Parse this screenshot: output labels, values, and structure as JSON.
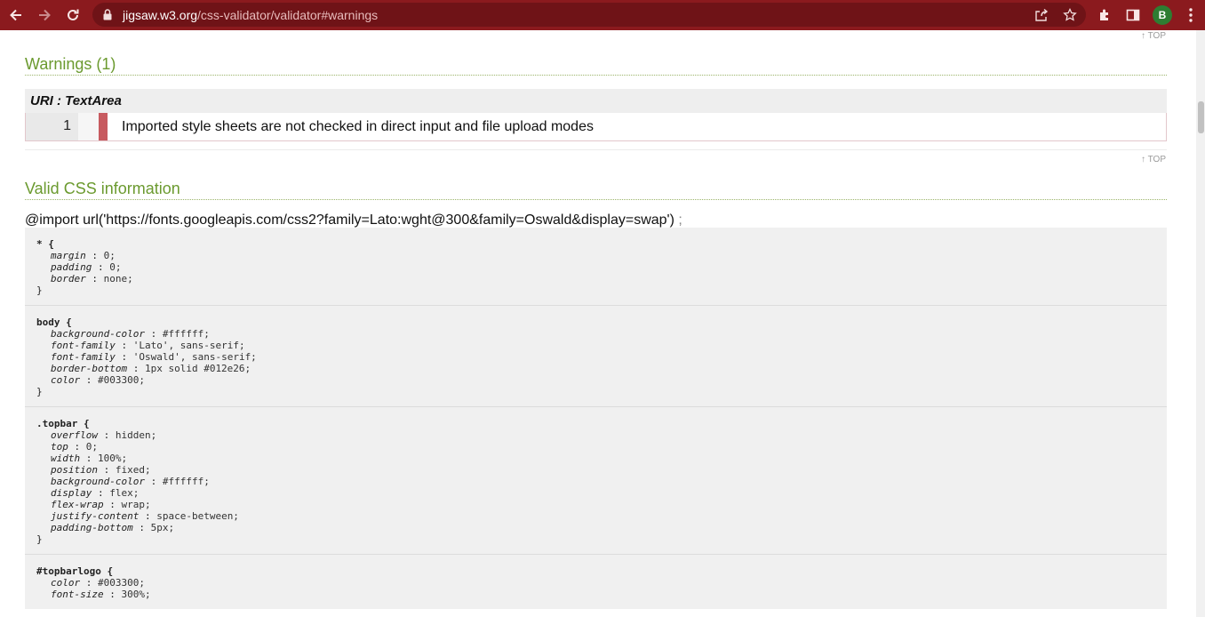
{
  "browser": {
    "url_domain": "jigsaw.w3.org",
    "url_path": "/css-validator/validator#warnings",
    "avatar_letter": "B",
    "theme_color": "#8b1a1e"
  },
  "icons": [
    "back-icon",
    "forward-icon",
    "reload-icon",
    "lock-icon",
    "share-icon",
    "star-icon",
    "extensions-icon",
    "side-panel-icon",
    "menu-icon"
  ],
  "page": {
    "top_link": "↑ TOP",
    "warnings": {
      "title": "Warnings (1)",
      "uri_label": "URI : TextArea",
      "items": [
        {
          "line": "1",
          "message": "Imported style sheets are not checked in direct input and file upload modes"
        }
      ]
    },
    "valid": {
      "title": "Valid CSS information",
      "import_text": "@import url('https://fonts.googleapis.com/css2?family=Lato:wght@300&family=Oswald&display=swap')",
      "import_semi": ";",
      "rules": [
        {
          "selector": "* {",
          "declarations": [
            {
              "prop": "margin",
              "value": "0;"
            },
            {
              "prop": "padding",
              "value": "0;"
            },
            {
              "prop": "border",
              "value": "none;"
            }
          ],
          "close": "}"
        },
        {
          "selector": "body {",
          "declarations": [
            {
              "prop": "background-color",
              "value": "#ffffff;"
            },
            {
              "prop": "font-family",
              "value": "'Lato', sans-serif;"
            },
            {
              "prop": "font-family",
              "value": "'Oswald', sans-serif;"
            },
            {
              "prop": "border-bottom",
              "value": "1px solid #012e26;"
            },
            {
              "prop": "color",
              "value": "#003300;"
            }
          ],
          "close": "}"
        },
        {
          "selector": ".topbar {",
          "declarations": [
            {
              "prop": "overflow",
              "value": "hidden;"
            },
            {
              "prop": "top",
              "value": "0;"
            },
            {
              "prop": "width",
              "value": "100%;"
            },
            {
              "prop": "position",
              "value": "fixed;"
            },
            {
              "prop": "background-color",
              "value": "#ffffff;"
            },
            {
              "prop": "display",
              "value": "flex;"
            },
            {
              "prop": "flex-wrap",
              "value": "wrap;"
            },
            {
              "prop": "justify-content",
              "value": "space-between;"
            },
            {
              "prop": "padding-bottom",
              "value": "5px;"
            }
          ],
          "close": "}"
        },
        {
          "selector": "#topbarlogo {",
          "declarations": [
            {
              "prop": "color",
              "value": "#003300;"
            },
            {
              "prop": "font-size",
              "value": "300%;"
            }
          ],
          "close": ""
        }
      ]
    }
  }
}
